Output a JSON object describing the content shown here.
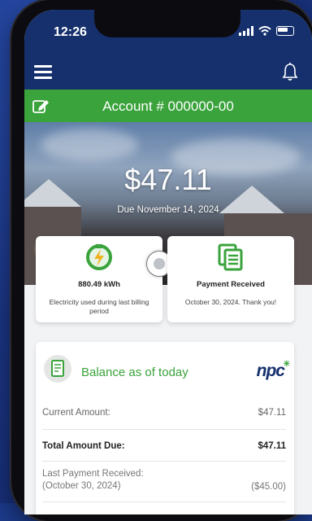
{
  "status_bar": {
    "time": "12:26"
  },
  "account": {
    "title": "Account # 000000-00"
  },
  "bill": {
    "amount": "$47.11",
    "due": "Due November 14, 2024"
  },
  "cards": [
    {
      "value": "880.49 kWh",
      "description": "Electricity used during last billing period",
      "icon": "electricity-icon"
    },
    {
      "value": "Payment Received",
      "description": "October 30, 2024. Thank you!",
      "icon": "document-icon"
    }
  ],
  "balance": {
    "title": "Balance as of today",
    "logo": "npc",
    "rows": [
      {
        "label": "Current Amount:",
        "value": "$47.11"
      },
      {
        "label": "Total Amount Due:",
        "value": "$47.11"
      },
      {
        "label": "Last Payment Received:",
        "label2": "(October 30, 2024)",
        "value": "($45.00)"
      }
    ]
  },
  "colors": {
    "navy": "#16306e",
    "green": "#3aa33c"
  }
}
